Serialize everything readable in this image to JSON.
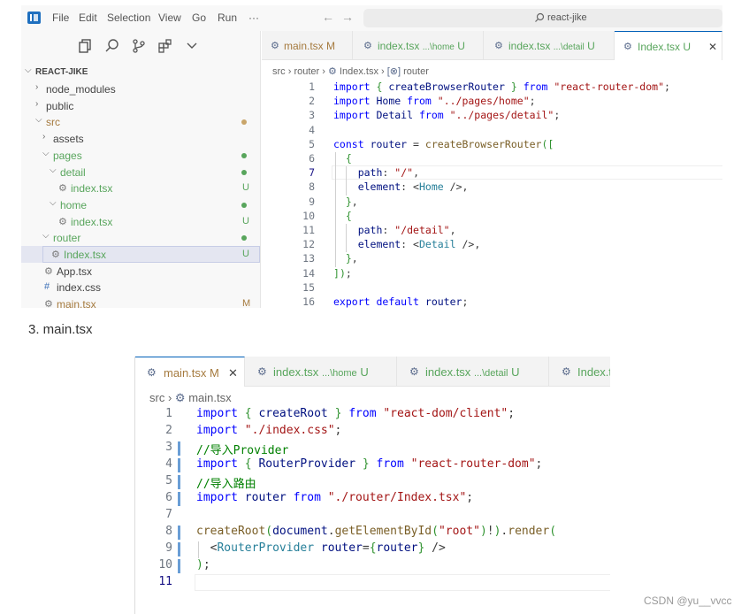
{
  "menubar": {
    "items": [
      "File",
      "Edit",
      "Selection",
      "View",
      "Go",
      "Run",
      "···"
    ],
    "search_label": "react-jike"
  },
  "explorer": {
    "root": "REACT-JIKE",
    "rows": [
      {
        "label": "node_modules",
        "kind": "folder",
        "open": false,
        "status": ""
      },
      {
        "label": "public",
        "kind": "folder",
        "open": false,
        "status": ""
      },
      {
        "label": "src",
        "kind": "folder",
        "open": true,
        "status": "dot-brown"
      },
      {
        "label": "assets",
        "kind": "folder",
        "open": false,
        "status": ""
      },
      {
        "label": "pages",
        "kind": "folder",
        "open": true,
        "status": "dot-green"
      },
      {
        "label": "detail",
        "kind": "folder",
        "open": true,
        "status": "dot-green"
      },
      {
        "label": "index.tsx",
        "kind": "file",
        "status": "U"
      },
      {
        "label": "home",
        "kind": "folder",
        "open": true,
        "status": "dot-green"
      },
      {
        "label": "index.tsx",
        "kind": "file",
        "status": "U"
      },
      {
        "label": "router",
        "kind": "folder",
        "open": true,
        "status": "dot-green"
      },
      {
        "label": "Index.tsx",
        "kind": "file",
        "status": "U"
      },
      {
        "label": "App.tsx",
        "kind": "file",
        "status": ""
      },
      {
        "label": "index.css",
        "kind": "css",
        "status": ""
      },
      {
        "label": "main.tsx",
        "kind": "file",
        "status": "M"
      }
    ]
  },
  "editor1": {
    "tabs": [
      {
        "label": "main.tsx",
        "status": "M"
      },
      {
        "label": "index.tsx",
        "hint": "...\\home",
        "status": "U"
      },
      {
        "label": "index.tsx",
        "hint": "...\\detail",
        "status": "U"
      },
      {
        "label": "Index.tsx",
        "status": "U",
        "close": "✕"
      }
    ],
    "breadcrumb": [
      "src",
      "router",
      "Index.tsx",
      "router"
    ],
    "line_numbers": [
      "1",
      "2",
      "3",
      "4",
      "5",
      "6",
      "7",
      "8",
      "9",
      "10",
      "11",
      "12",
      "13",
      "14",
      "15",
      "16"
    ],
    "lines": [
      "import { createBrowserRouter } from \"react-router-dom\";",
      "import Home from \"../pages/home\";",
      "import Detail from \"../pages/detail\";",
      "",
      "const router = createBrowserRouter([",
      "  {",
      "    path: \"/\",",
      "    element: <Home />,",
      "  },",
      "  {",
      "    path: \"/detail\",",
      "    element: <Detail />,",
      "  },",
      "]);",
      "",
      "export default router;"
    ]
  },
  "section_heading": "3. main.tsx",
  "editor2": {
    "tabs": [
      {
        "label": "main.tsx",
        "status": "M",
        "close": "✕"
      },
      {
        "label": "index.tsx",
        "hint": "...\\home",
        "status": "U"
      },
      {
        "label": "index.tsx",
        "hint": "...\\detail",
        "status": "U"
      },
      {
        "label": "Index.t"
      }
    ],
    "breadcrumb": [
      "src",
      "main.tsx"
    ],
    "line_numbers": [
      "1",
      "2",
      "3",
      "4",
      "5",
      "6",
      "7",
      "8",
      "9",
      "10",
      "11"
    ],
    "lines": [
      "import { createRoot } from \"react-dom/client\";",
      "import \"./index.css\";",
      "//导入Provider",
      "import { RouterProvider } from \"react-router-dom\";",
      "//导入路由",
      "import router from \"./router/Index.tsx\";",
      "",
      "createRoot(document.getElementById(\"root\")!).render(",
      "  <RouterProvider router={router} />",
      ");",
      ""
    ]
  },
  "watermark": "CSDN @yu__vvcc",
  "colors": {
    "accent": "#005fb8",
    "untracked": "#58a55c",
    "modified": "#a57a3e",
    "keyword": "#0000ff",
    "string": "#a31515",
    "comment": "#008000"
  }
}
